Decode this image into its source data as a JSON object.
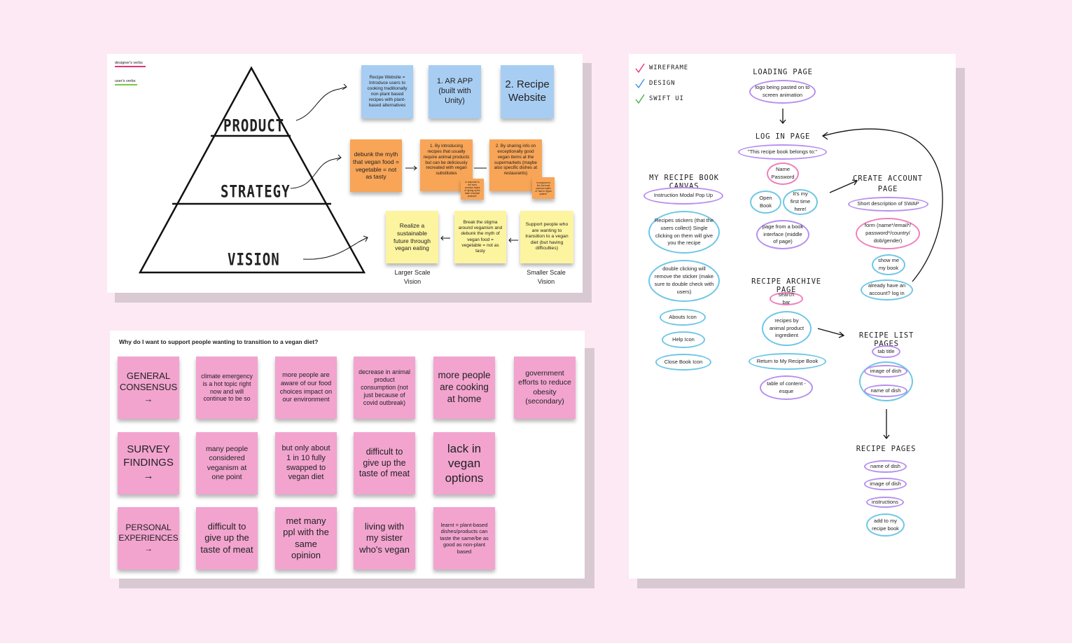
{
  "board1": {
    "legend": [
      {
        "text": "designer's verbs",
        "color": "#e5317d"
      },
      {
        "text": "user's verbs",
        "color": "#7ac943"
      }
    ],
    "pyramid": [
      "PRODUCT",
      "STRATEGY",
      "VISION"
    ],
    "product_notes": [
      "Recipe Website = Introduce users to cooking traditionally non-plant based recipes with plant-based alternatives",
      "1. AR APP (built with Unity)",
      "2. Recipe Website"
    ],
    "strategy_notes": {
      "main": "debunk the myth that vegan food = vegetable = not as tasty",
      "one": "1. By introducing recipes that usually require animal products but can be deliciously recreated with vegan substitutes",
      "one_small": "in response to the most common myths of \"giving up the taste of animal products\"",
      "two": "2. By sharing info on exceptionally good vegan items at the supermarkets (maybe also specific dishes at restaurants)",
      "two_small": "in response to the 2nd most common myths of \"lack in vegan options\""
    },
    "vision_notes": {
      "left": "Realize a sustainable future through vegan eating",
      "middle": "Break the stigma around veganism and debunk the myth of vegan food = vegetable = not as tasty",
      "right": "Support people who are wanting to transition to a vegan diet (but having difficulties)"
    },
    "vision_captions": [
      "Larger Scale Vision",
      "Smaller Scale Vision"
    ]
  },
  "board2": {
    "question": "Why do I want to support people wanting to transition to a vegan diet?",
    "rows": [
      [
        "GENERAL CONSENSUS →",
        "climate emergency is a hot topic right now and will continue to be so",
        "more people are aware of our food choices impact on our environment",
        "decrease in animal product consumption (not just because of covid outbreak)",
        "more people are cooking at home",
        "government efforts to reduce obesity (secondary)"
      ],
      [
        "SURVEY FINDINGS →",
        "many people considered veganism at one point",
        "but only about 1 in 10 fully swapped to vegan diet",
        "difficult to give up the taste of meat",
        "lack in vegan options"
      ],
      [
        "PERSONAL EXPERIENCES →",
        "difficult to give up the taste of meat",
        "met many ppl with the same opinion",
        "living with my sister who's vegan",
        "learnt = plant-based dishes/products can taste the same/be as good as non-plant based"
      ]
    ]
  },
  "board3": {
    "legend": [
      {
        "text": "WIREFRAME",
        "color": "#e5317d"
      },
      {
        "text": "DESIGN",
        "color": "#3a8ee6"
      },
      {
        "text": "SWIFT UI",
        "color": "#4cae4c"
      }
    ],
    "loading": {
      "title": "LOADING PAGE",
      "items": [
        "logo being pasted on to screen animation"
      ]
    },
    "login": {
      "title": "LOG IN PAGE",
      "items": [
        "\"This recipe book belongs to:\"",
        "Name Password",
        "Open Book",
        "It's my first time here!",
        "page from a book interface (middle of page)"
      ]
    },
    "canvas": {
      "title": "MY RECIPE BOOK CANVAS",
      "items": [
        "Instruction Modal Pop Up",
        "Recipes stickers (that the users collect) Single clicking on them will give you the recipe",
        "double clicking will remove the sticker (make sure to double check with users)",
        "Abouts Icon",
        "Help Icon",
        "Close Book Icon"
      ]
    },
    "create": {
      "title": "CREATE ACCOUNT PAGE",
      "items": [
        "Short description of SWAP",
        "form (name*/email*/ password*/country/ dob/gender)",
        "show me my book",
        "already have an account? log in"
      ]
    },
    "archive": {
      "title": "RECIPE ARCHIVE PAGE",
      "items": [
        "search bar",
        "recipes by animal product ingredient",
        "Return to My Recipe Book",
        "table of content -esque"
      ]
    },
    "list": {
      "title": "RECIPE LIST PAGES",
      "items": [
        "tab title",
        "image of dish",
        "name of dish"
      ]
    },
    "recipe": {
      "title": "RECIPE PAGES",
      "items": [
        "name of dish",
        "image of dish",
        "instructions",
        "add to my recipe book"
      ]
    }
  }
}
